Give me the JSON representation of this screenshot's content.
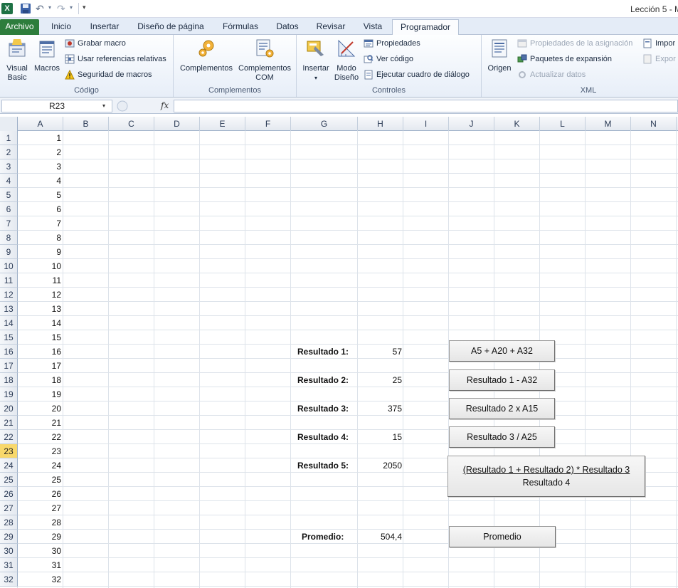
{
  "window": {
    "title": "Lección 5 - M"
  },
  "quick_access": {
    "excel_icon": "X"
  },
  "tabs": {
    "file": "Archivo",
    "items": [
      "Inicio",
      "Insertar",
      "Diseño de página",
      "Fórmulas",
      "Datos",
      "Revisar",
      "Vista",
      "Programador"
    ],
    "active": "Programador"
  },
  "ribbon": {
    "codigo": {
      "label": "Código",
      "visual_basic": "Visual Basic",
      "macros": "Macros",
      "grabar": "Grabar macro",
      "referencias": "Usar referencias relativas",
      "seguridad": "Seguridad de macros"
    },
    "complementos": {
      "label": "Complementos",
      "complementos": "Complementos",
      "com": "Complementos COM"
    },
    "controles": {
      "label": "Controles",
      "insertar": "Insertar",
      "modo": "Modo Diseño",
      "propiedades": "Propiedades",
      "ver_codigo": "Ver código",
      "ejecutar": "Ejecutar cuadro de diálogo"
    },
    "xml": {
      "label": "XML",
      "origen": "Origen",
      "propiedades_asig": "Propiedades de la asignación",
      "paquetes": "Paquetes de expansión",
      "actualizar": "Actualizar datos",
      "importar": "Impor",
      "exportar": "Expor"
    }
  },
  "formula_bar": {
    "namebox": "R23",
    "fx": "fx",
    "formula": ""
  },
  "columns": [
    "A",
    "B",
    "C",
    "D",
    "E",
    "F",
    "G",
    "H",
    "I",
    "J",
    "K",
    "L",
    "M",
    "N"
  ],
  "rows": [
    "1",
    "2",
    "3",
    "4",
    "5",
    "6",
    "7",
    "8",
    "9",
    "10",
    "11",
    "12",
    "13",
    "14",
    "15",
    "16",
    "17",
    "18",
    "19",
    "20",
    "21",
    "22",
    "23",
    "24",
    "25",
    "26",
    "27",
    "28",
    "29",
    "30",
    "31",
    "32"
  ],
  "active_row": "23",
  "col_a_values": [
    "1",
    "2",
    "3",
    "4",
    "5",
    "6",
    "7",
    "8",
    "9",
    "10",
    "11",
    "12",
    "13",
    "14",
    "15",
    "16",
    "17",
    "18",
    "19",
    "20",
    "21",
    "22",
    "23",
    "24",
    "25",
    "26",
    "27",
    "28",
    "29",
    "30",
    "31",
    "32"
  ],
  "results": [
    {
      "label": "Resultado 1:",
      "value": "57"
    },
    {
      "label": "Resultado 2:",
      "value": "25"
    },
    {
      "label": "Resultado 3:",
      "value": "375"
    },
    {
      "label": "Resultado 4:",
      "value": "15"
    },
    {
      "label": "Resultado 5:",
      "value": "2050"
    },
    {
      "label": "Promedio:",
      "value": "504,4"
    }
  ],
  "buttons": {
    "b1": "A5 + A20 + A32",
    "b2": "Resultado 1 - A32",
    "b3": "Resultado 2 x A15",
    "b4": "Resultado 3 / A25",
    "b5_line1": "(Resultado 1 + Resultado 2) * Resultado 3",
    "b5_line2": "Resultado 4",
    "b6": "Promedio"
  }
}
